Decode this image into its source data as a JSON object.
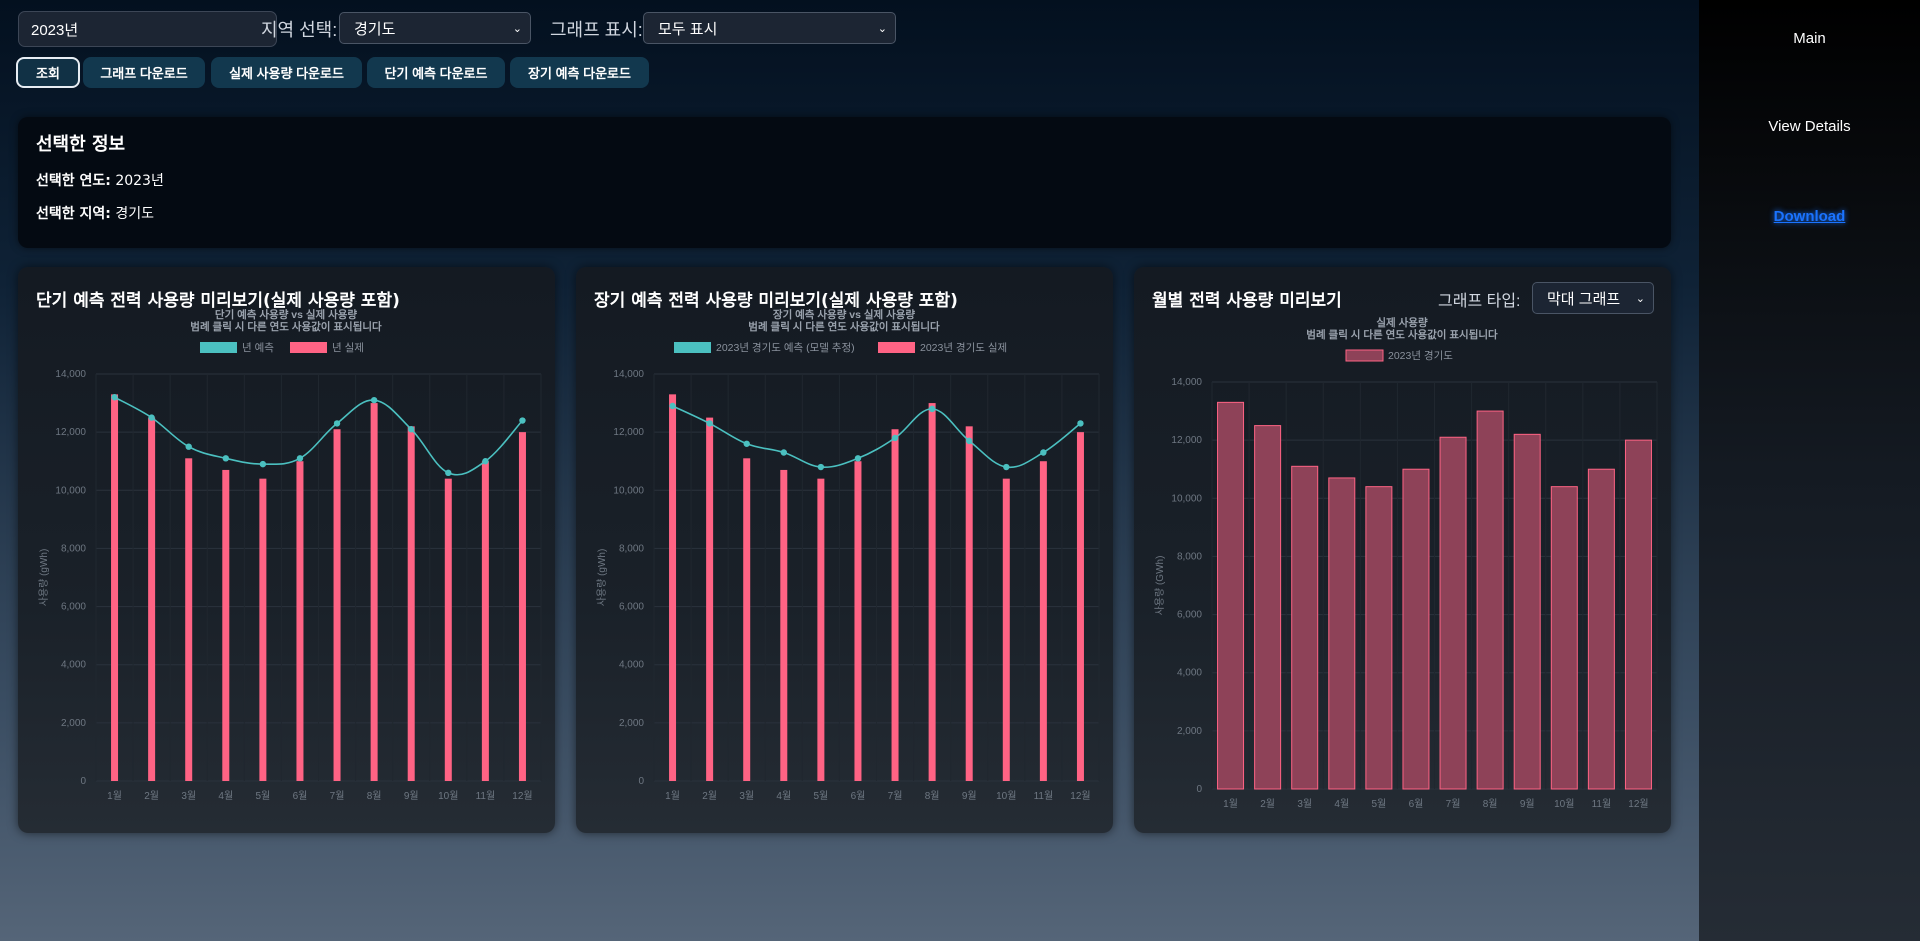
{
  "controls": {
    "year_value": "2023년",
    "region_label": "지역 선택:",
    "region_value": "경기도",
    "display_label": "그래프 표시:",
    "display_value": "모두 표시"
  },
  "buttons": {
    "search": "조회",
    "download_graph": "그래프 다운로드",
    "download_actual": "실제 사용량 다운로드",
    "download_short": "단기 예측 다운로드",
    "download_long": "장기 예측 다운로드"
  },
  "info": {
    "title": "선택한 정보",
    "year_label": "선택한 연도:",
    "year_value": "2023년",
    "region_label": "선택한 지역:",
    "region_value": "경기도"
  },
  "sidebar": {
    "items": [
      {
        "label": "Main"
      },
      {
        "label": "View Details"
      },
      {
        "label": "Download"
      }
    ]
  },
  "panels": {
    "short": {
      "title": "단기 예측 전력 사용량 미리보기(실제 사용량 포함)"
    },
    "long": {
      "title": "장기 예측 전력 사용량 미리보기(실제 사용량 포함)"
    },
    "monthly": {
      "title": "월별 전력 사용량 미리보기",
      "type_label": "그래프 타입:",
      "type_value": "막대 그래프"
    }
  },
  "colors": {
    "actual": "#ff6384",
    "forecast": "#4bc0c0",
    "bar_fill": "#8e4258",
    "accent": "#1a73ff"
  },
  "icons": {
    "dropdown": "chevron-down-icon"
  },
  "chart_data": [
    {
      "type": "bar",
      "subtitle": [
        "단기 예측 사용량 vs 실제 사용량",
        "범례 클릭 시 다른 연도 사용값이 표시됩니다"
      ],
      "categories": [
        "1월",
        "2월",
        "3월",
        "4월",
        "5월",
        "6월",
        "7월",
        "8월",
        "9월",
        "10월",
        "11월",
        "12월"
      ],
      "ylabel": "사용량 (gWh)",
      "ylim": [
        0,
        14000
      ],
      "yticks": [
        "0",
        "2,000",
        "4,000",
        "6,000",
        "8,000",
        "10,000",
        "12,000",
        "14,000"
      ],
      "series": [
        {
          "name": "년 예측",
          "kind": "line",
          "values": [
            13200,
            12500,
            11500,
            11100,
            10900,
            11100,
            12300,
            13100,
            12100,
            10600,
            11000,
            12400
          ]
        },
        {
          "name": "년 실제",
          "kind": "bar",
          "values": [
            13300,
            12500,
            11100,
            10700,
            10400,
            11000,
            12100,
            13000,
            12200,
            10400,
            11000,
            12000
          ]
        }
      ]
    },
    {
      "type": "bar",
      "subtitle": [
        "장기 예측 사용량 vs 실제 사용량",
        "범례 클릭 시 다른 연도 사용값이 표시됩니다"
      ],
      "categories": [
        "1월",
        "2월",
        "3월",
        "4월",
        "5월",
        "6월",
        "7월",
        "8월",
        "9월",
        "10월",
        "11월",
        "12월"
      ],
      "ylabel": "사용량 (gWh)",
      "ylim": [
        0,
        14000
      ],
      "yticks": [
        "0",
        "2,000",
        "4,000",
        "6,000",
        "8,000",
        "10,000",
        "12,000",
        "14,000"
      ],
      "series": [
        {
          "name": "2023년 경기도 예측 (모델 추정)",
          "kind": "line",
          "values": [
            12900,
            12300,
            11600,
            11300,
            10800,
            11100,
            11800,
            12800,
            11700,
            10800,
            11300,
            12300
          ]
        },
        {
          "name": "2023년 경기도 실제",
          "kind": "bar",
          "values": [
            13300,
            12500,
            11100,
            10700,
            10400,
            11000,
            12100,
            13000,
            12200,
            10400,
            11000,
            12000
          ]
        }
      ]
    },
    {
      "type": "bar",
      "subtitle": [
        "실제 사용량",
        "범례 클릭 시 다른 연도 사용값이 표시됩니다"
      ],
      "categories": [
        "1월",
        "2월",
        "3월",
        "4월",
        "5월",
        "6월",
        "7월",
        "8월",
        "9월",
        "10월",
        "11월",
        "12월"
      ],
      "ylabel": "사용량 (GWh)",
      "ylim": [
        0,
        14000
      ],
      "yticks": [
        "0",
        "2,000",
        "4,000",
        "6,000",
        "8,000",
        "10,000",
        "12,000",
        "14,000"
      ],
      "series": [
        {
          "name": "2023년 경기도",
          "kind": "bar",
          "values": [
            13300,
            12500,
            11100,
            10700,
            10400,
            11000,
            12100,
            13000,
            12200,
            10400,
            11000,
            12000
          ]
        }
      ]
    }
  ]
}
